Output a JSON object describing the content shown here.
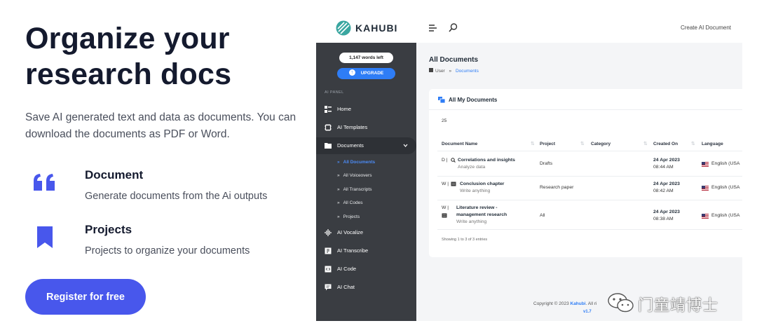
{
  "hero": {
    "title": "Organize your research docs",
    "subtitle": "Save AI generated text and data as documents. You can download the documents as PDF or Word.",
    "features": [
      {
        "title": "Document",
        "desc": "Generate documents from the Ai outputs",
        "icon": "quote-icon"
      },
      {
        "title": "Projects",
        "desc": "Projects to organize your documents",
        "icon": "bookmark-icon"
      }
    ],
    "cta_label": "Register for free"
  },
  "app": {
    "logo_text": "KAHUBI",
    "create_label": "Create AI Document",
    "sidebar": {
      "words_left": "1,147 words left",
      "upgrade_label": "UPGRADE",
      "panel_label": "AI PANEL",
      "items": [
        {
          "label": "Home",
          "icon": "home-icon"
        },
        {
          "label": "AI Templates",
          "icon": "templates-icon"
        },
        {
          "label": "Documents",
          "icon": "folder-icon"
        },
        {
          "label": "AI Vocalize",
          "icon": "waveform-icon"
        },
        {
          "label": "AI Transcribe",
          "icon": "transcribe-icon"
        },
        {
          "label": "AI Code",
          "icon": "code-icon"
        },
        {
          "label": "AI Chat",
          "icon": "chat-icon"
        }
      ],
      "sub_items": [
        "All Documents",
        "All Voiceovers",
        "All Transcripts",
        "All Codes",
        "Projects"
      ]
    },
    "main": {
      "title": "All Documents",
      "breadcrumb": {
        "root": "User",
        "sep": "»",
        "current": "Documents"
      },
      "card_title": "All My Documents",
      "page_size": "25",
      "columns": [
        "Document Name",
        "Project",
        "Category",
        "Created On",
        "Language"
      ],
      "rows": [
        {
          "type": "D |",
          "name": "Correlations and insights",
          "name2": "",
          "sub": "Analyze data",
          "project": "Drafts",
          "date": "24 Apr 2023",
          "time": "08:44 AM",
          "language": "English (USA"
        },
        {
          "type": "W |",
          "name": "Conclusion chapter",
          "name2": "",
          "sub": "Write anything",
          "project": "Research paper",
          "date": "24 Apr 2023",
          "time": "08:42 AM",
          "language": "English (USA"
        },
        {
          "type": "W |",
          "name": "Literature review -",
          "name2": "management research",
          "sub": "Write anything",
          "project": "All",
          "date": "24 Apr 2023",
          "time": "08:38 AM",
          "language": "English (USA"
        }
      ],
      "showing": "Showing 1 to 3 of 3 entries"
    },
    "footer": {
      "copyright": "Copyright © 2023",
      "brand": "Kahubi",
      "rest": ". All ri",
      "version": "v1.7"
    }
  },
  "watermark": {
    "text": "门童靖博士",
    "icon": "wechat-icon"
  },
  "colors": {
    "accent": "#4857ec",
    "sidebar": "#3a3d42",
    "link": "#2e7df6",
    "title": "#141a2e"
  }
}
